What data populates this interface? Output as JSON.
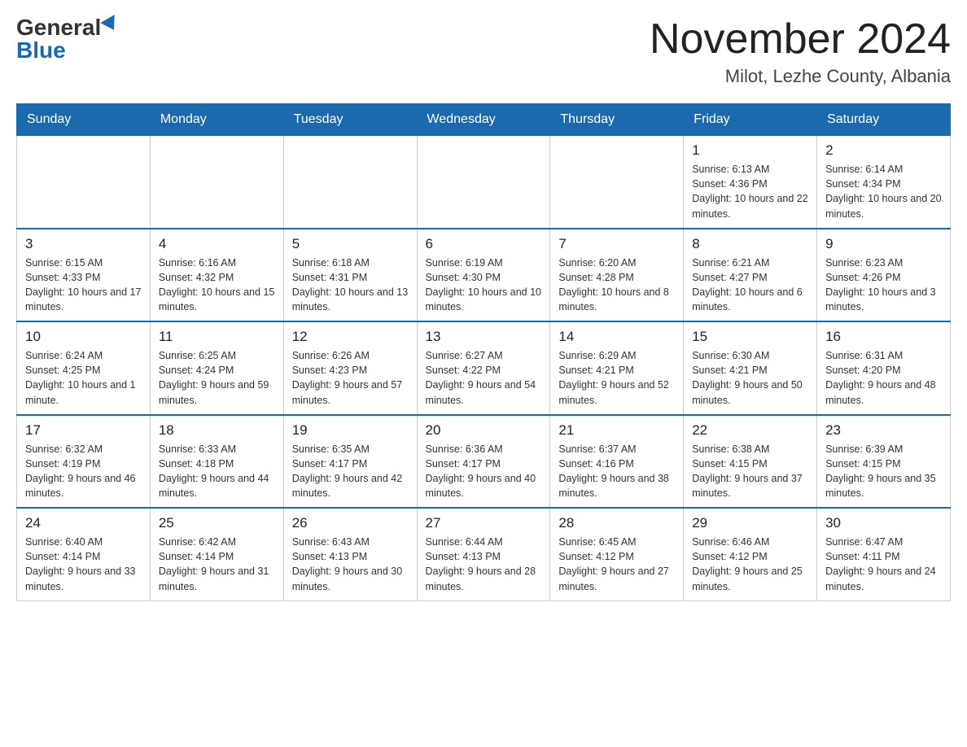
{
  "logo": {
    "general": "General",
    "blue": "Blue"
  },
  "title": {
    "month": "November 2024",
    "location": "Milot, Lezhe County, Albania"
  },
  "weekdays": [
    "Sunday",
    "Monday",
    "Tuesday",
    "Wednesday",
    "Thursday",
    "Friday",
    "Saturday"
  ],
  "rows": [
    [
      {
        "day": "",
        "info": ""
      },
      {
        "day": "",
        "info": ""
      },
      {
        "day": "",
        "info": ""
      },
      {
        "day": "",
        "info": ""
      },
      {
        "day": "",
        "info": ""
      },
      {
        "day": "1",
        "info": "Sunrise: 6:13 AM\nSunset: 4:36 PM\nDaylight: 10 hours and 22 minutes."
      },
      {
        "day": "2",
        "info": "Sunrise: 6:14 AM\nSunset: 4:34 PM\nDaylight: 10 hours and 20 minutes."
      }
    ],
    [
      {
        "day": "3",
        "info": "Sunrise: 6:15 AM\nSunset: 4:33 PM\nDaylight: 10 hours and 17 minutes."
      },
      {
        "day": "4",
        "info": "Sunrise: 6:16 AM\nSunset: 4:32 PM\nDaylight: 10 hours and 15 minutes."
      },
      {
        "day": "5",
        "info": "Sunrise: 6:18 AM\nSunset: 4:31 PM\nDaylight: 10 hours and 13 minutes."
      },
      {
        "day": "6",
        "info": "Sunrise: 6:19 AM\nSunset: 4:30 PM\nDaylight: 10 hours and 10 minutes."
      },
      {
        "day": "7",
        "info": "Sunrise: 6:20 AM\nSunset: 4:28 PM\nDaylight: 10 hours and 8 minutes."
      },
      {
        "day": "8",
        "info": "Sunrise: 6:21 AM\nSunset: 4:27 PM\nDaylight: 10 hours and 6 minutes."
      },
      {
        "day": "9",
        "info": "Sunrise: 6:23 AM\nSunset: 4:26 PM\nDaylight: 10 hours and 3 minutes."
      }
    ],
    [
      {
        "day": "10",
        "info": "Sunrise: 6:24 AM\nSunset: 4:25 PM\nDaylight: 10 hours and 1 minute."
      },
      {
        "day": "11",
        "info": "Sunrise: 6:25 AM\nSunset: 4:24 PM\nDaylight: 9 hours and 59 minutes."
      },
      {
        "day": "12",
        "info": "Sunrise: 6:26 AM\nSunset: 4:23 PM\nDaylight: 9 hours and 57 minutes."
      },
      {
        "day": "13",
        "info": "Sunrise: 6:27 AM\nSunset: 4:22 PM\nDaylight: 9 hours and 54 minutes."
      },
      {
        "day": "14",
        "info": "Sunrise: 6:29 AM\nSunset: 4:21 PM\nDaylight: 9 hours and 52 minutes."
      },
      {
        "day": "15",
        "info": "Sunrise: 6:30 AM\nSunset: 4:21 PM\nDaylight: 9 hours and 50 minutes."
      },
      {
        "day": "16",
        "info": "Sunrise: 6:31 AM\nSunset: 4:20 PM\nDaylight: 9 hours and 48 minutes."
      }
    ],
    [
      {
        "day": "17",
        "info": "Sunrise: 6:32 AM\nSunset: 4:19 PM\nDaylight: 9 hours and 46 minutes."
      },
      {
        "day": "18",
        "info": "Sunrise: 6:33 AM\nSunset: 4:18 PM\nDaylight: 9 hours and 44 minutes."
      },
      {
        "day": "19",
        "info": "Sunrise: 6:35 AM\nSunset: 4:17 PM\nDaylight: 9 hours and 42 minutes."
      },
      {
        "day": "20",
        "info": "Sunrise: 6:36 AM\nSunset: 4:17 PM\nDaylight: 9 hours and 40 minutes."
      },
      {
        "day": "21",
        "info": "Sunrise: 6:37 AM\nSunset: 4:16 PM\nDaylight: 9 hours and 38 minutes."
      },
      {
        "day": "22",
        "info": "Sunrise: 6:38 AM\nSunset: 4:15 PM\nDaylight: 9 hours and 37 minutes."
      },
      {
        "day": "23",
        "info": "Sunrise: 6:39 AM\nSunset: 4:15 PM\nDaylight: 9 hours and 35 minutes."
      }
    ],
    [
      {
        "day": "24",
        "info": "Sunrise: 6:40 AM\nSunset: 4:14 PM\nDaylight: 9 hours and 33 minutes."
      },
      {
        "day": "25",
        "info": "Sunrise: 6:42 AM\nSunset: 4:14 PM\nDaylight: 9 hours and 31 minutes."
      },
      {
        "day": "26",
        "info": "Sunrise: 6:43 AM\nSunset: 4:13 PM\nDaylight: 9 hours and 30 minutes."
      },
      {
        "day": "27",
        "info": "Sunrise: 6:44 AM\nSunset: 4:13 PM\nDaylight: 9 hours and 28 minutes."
      },
      {
        "day": "28",
        "info": "Sunrise: 6:45 AM\nSunset: 4:12 PM\nDaylight: 9 hours and 27 minutes."
      },
      {
        "day": "29",
        "info": "Sunrise: 6:46 AM\nSunset: 4:12 PM\nDaylight: 9 hours and 25 minutes."
      },
      {
        "day": "30",
        "info": "Sunrise: 6:47 AM\nSunset: 4:11 PM\nDaylight: 9 hours and 24 minutes."
      }
    ]
  ]
}
